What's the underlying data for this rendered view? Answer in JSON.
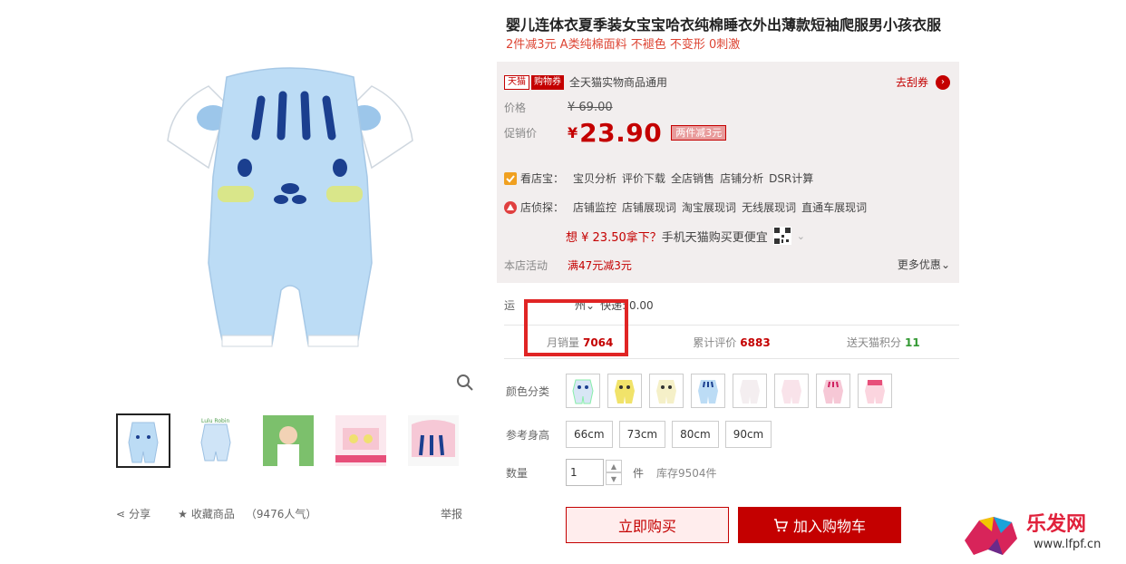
{
  "product": {
    "title": "婴儿连体衣夏季装女宝宝哈衣纯棉睡衣外出薄款短袖爬服男小孩衣服",
    "subtitle": "2件减3元 A类纯棉面料 不褪色 不变形 0刺激"
  },
  "coupon": {
    "tm_tag": "天猫",
    "coupon_tag": "购物券",
    "text": "全天猫实物商品通用",
    "get_label": "去刮券",
    "go_icon": "chevron-right-icon"
  },
  "price": {
    "price_label": "价格",
    "old_price": "¥ 69.00",
    "promo_label": "促销价",
    "currency": "¥",
    "promo_price": "23.90",
    "promo_badge": "两件减3元"
  },
  "tools": {
    "shop_label": "看店宝：",
    "shop_links": [
      "宝贝分析",
      "评价下载",
      "全店销售",
      "店铺分析",
      "DSR计算"
    ],
    "detect_label": "店侦探：",
    "detect_links": [
      "店铺监控",
      "店铺展现词",
      "淘宝展现词",
      "无线展现词",
      "直通车展现词"
    ]
  },
  "mobile": {
    "prefix": "想 ¥ 23.50拿下？",
    "text": "手机天猫购买更便宜"
  },
  "activity": {
    "label": "本店活动",
    "value": "满47元减3元",
    "more": "更多优惠"
  },
  "shipping": {
    "label": "运",
    "to": "州",
    "fee": "快递: 0.00"
  },
  "stats": {
    "monthly_label": "月销量",
    "monthly_value": "7064",
    "reviews_label": "累计评价",
    "reviews_value": "6883",
    "points_label": "送天猫积分",
    "points_value": "11"
  },
  "sku": {
    "color_label": "颜色分类",
    "size_label": "参考身高",
    "sizes": [
      "66cm",
      "73cm",
      "80cm",
      "90cm"
    ],
    "qty_label": "数量",
    "qty_value": "1",
    "unit": "件",
    "stock": "库存9504件"
  },
  "actions": {
    "buy_now": "立即购买",
    "add_cart": "加入购物车"
  },
  "gallery": {
    "share": "分享",
    "favorite": "收藏商品",
    "popularity": "（9476人气）",
    "report": "举报"
  },
  "watermark": {
    "text": "乐发网",
    "url": "www.lfpf.cn"
  },
  "colors": {
    "accent": "#c40000",
    "highlight_box": "#e02424"
  }
}
